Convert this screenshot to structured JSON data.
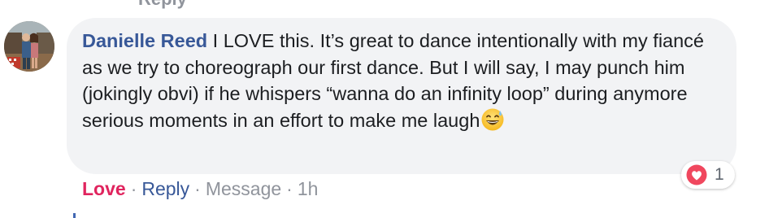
{
  "prev_comment": {
    "reply_label": "Reply"
  },
  "comment": {
    "author": "Danielle Reed",
    "text": " I LOVE this. It’s great to dance intentionally with my fiancé as we try to choreograph our first dance. But I will say, I may punch him (jokingly obvi) if he whispers “wanna do an infinity loop” during anymore serious moments in an effort to make me laugh",
    "emoji_icon": "grinning-sweat-emoji"
  },
  "actions": {
    "love_label": "Love",
    "separator": "·",
    "reply_label": "Reply",
    "message_label": "Message",
    "time": "1h"
  },
  "reactions": {
    "icon": "love-heart-icon",
    "count": "1"
  },
  "colors": {
    "author": "#385898",
    "love": "#e0245e",
    "bubble": "#f2f3f5",
    "muted": "#90949c"
  }
}
